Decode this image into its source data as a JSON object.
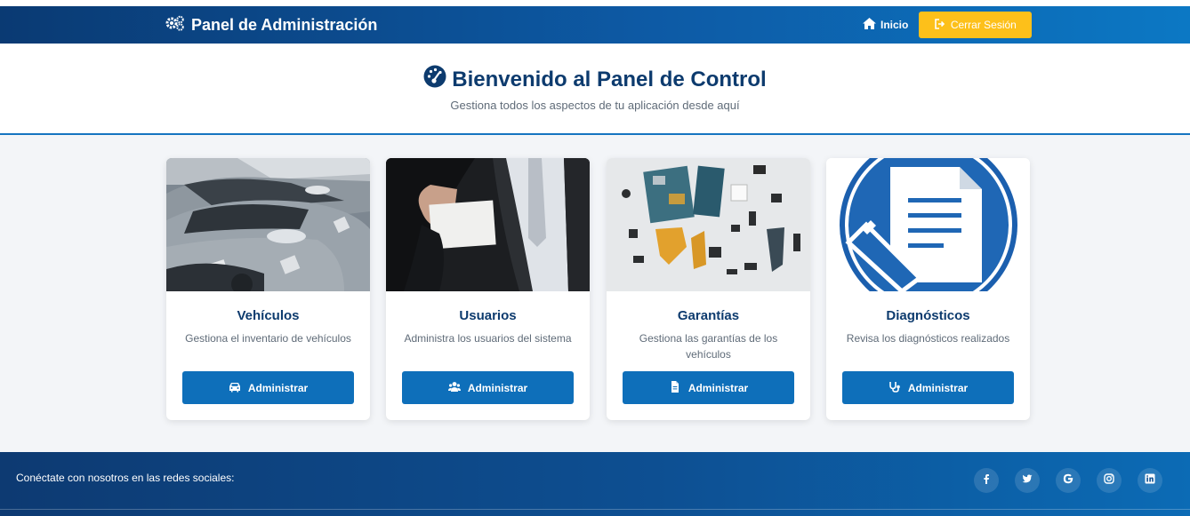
{
  "navbar": {
    "brand": "Panel de Administración",
    "home_label": "Inicio",
    "logout_label": "Cerrar Sesión"
  },
  "hero": {
    "title": "Bienvenido al Panel de Control",
    "subtitle": "Gestiona todos los aspectos de tu aplicación desde aquí"
  },
  "cards": [
    {
      "title": "Vehículos",
      "description": "Gestiona el inventario de vehículos",
      "button": "Administrar",
      "icon": "car-icon"
    },
    {
      "title": "Usuarios",
      "description": "Administra los usuarios del sistema",
      "button": "Administrar",
      "icon": "users-icon"
    },
    {
      "title": "Garantías",
      "description": "Gestiona las garantías de los vehículos",
      "button": "Administrar",
      "icon": "file-icon"
    },
    {
      "title": "Diagnósticos",
      "description": "Revisa los diagnósticos realizados",
      "button": "Administrar",
      "icon": "stethoscope-icon"
    }
  ],
  "footer": {
    "text": "Conéctate con nosotros en las redes sociales:",
    "socials": [
      "facebook-icon",
      "twitter-icon",
      "google-icon",
      "instagram-icon",
      "linkedin-icon"
    ]
  },
  "colors": {
    "navbar": "#0d5aa5",
    "accent": "#fdc01a",
    "button": "#0e6fba",
    "title": "#0d3b6e"
  }
}
